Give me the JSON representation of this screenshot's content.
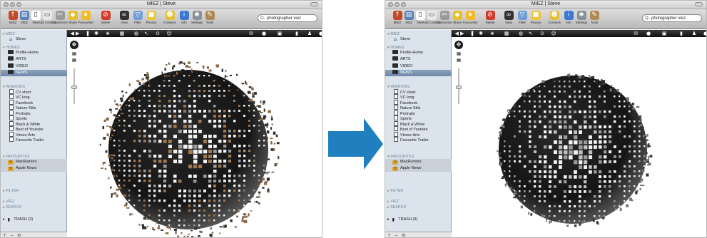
{
  "window": {
    "title": "MIEZ | Steve"
  },
  "toolbar": {
    "buttons": [
      {
        "label": "MIEZ",
        "icon": "miez-icon",
        "color": "#c04a2a"
      },
      {
        "label": "VIEZ",
        "icon": "viez-icon",
        "color": "#5a82b7"
      },
      {
        "label": "New",
        "icon": "new-icon",
        "color": "#ffffff"
      },
      {
        "label": "Add Content",
        "icon": "add-content-icon",
        "color": "#e9e9e9"
      },
      {
        "label": "Customize",
        "icon": "customize-icon",
        "color": "#9a9a9a"
      },
      {
        "label": "Share",
        "icon": "share-icon",
        "color": "#e6bf29"
      },
      {
        "label": "Favourites",
        "icon": "star-icon",
        "color": "#f2b923"
      },
      {
        "label": "Delete",
        "icon": "delete-icon",
        "color": "#d23a2a"
      },
      {
        "label": "View",
        "icon": "binoculars-icon",
        "color": "#333333"
      },
      {
        "label": "Filter",
        "icon": "filter-icon",
        "color": "#6f9ed4"
      },
      {
        "label": "Privacy",
        "icon": "lock-icon",
        "color": "#f0c333"
      },
      {
        "label": "Contacts",
        "icon": "contacts-icon",
        "color": "#e4c039"
      },
      {
        "label": "Info",
        "icon": "info-icon",
        "color": "#3b78d2"
      },
      {
        "label": "Settings",
        "icon": "gear-icon",
        "color": "#8a8f98"
      },
      {
        "label": "Tools",
        "icon": "tools-icon",
        "color": "#b08a55"
      }
    ],
    "search_value": "photographer viez",
    "search_icon": "search-icon"
  },
  "sidebar": {
    "sections": [
      {
        "heading": "MIEZ",
        "items": [
          {
            "label": "Steve",
            "icon": "home-icon"
          }
        ]
      },
      {
        "heading": "HOMES",
        "items": [
          {
            "label": "Profile-Home",
            "icon": "laptop-icon"
          },
          {
            "label": "ARTS",
            "icon": "laptop-icon"
          },
          {
            "label": "VIDEO",
            "icon": "laptop-icon"
          },
          {
            "label": "NEWS",
            "icon": "laptop-icon",
            "selected": true
          }
        ]
      },
      {
        "heading": "WINDOWS",
        "items": [
          {
            "label": "CV short",
            "icon": "document-icon"
          },
          {
            "label": "VC long",
            "icon": "document-icon"
          },
          {
            "label": "Facebook",
            "icon": "document-icon"
          },
          {
            "label": "Nature Stils",
            "icon": "document-icon"
          },
          {
            "label": "Portraits",
            "icon": "document-icon"
          },
          {
            "label": "Sports",
            "icon": "document-icon"
          },
          {
            "label": "Black & White",
            "icon": "document-icon"
          },
          {
            "label": "Best of Youtube",
            "icon": "document-icon"
          },
          {
            "label": "Vimeo-Arts",
            "icon": "document-icon"
          },
          {
            "label": "Favourite Trailer",
            "icon": "document-icon"
          }
        ]
      },
      {
        "heading": "FAVOURITES",
        "items": [
          {
            "label": "MacRumors",
            "icon": "rss-icon",
            "highlighted": true
          },
          {
            "label": "Apple News",
            "icon": "rss-icon",
            "highlighted": true
          }
        ]
      },
      {
        "heading": "FILTER",
        "items": []
      },
      {
        "heading": "VIEZ",
        "items": []
      },
      {
        "heading": "SEARCH",
        "items": []
      },
      {
        "heading": "TRASH (3)",
        "items": [],
        "icon": "trash-icon"
      }
    ],
    "footer": {
      "add": "+",
      "remove": "−",
      "gear": "⚙"
    }
  },
  "content_toolbar": {
    "left_buttons": [
      "◀ ▶",
      "❚",
      "✺",
      "★",
      "▦",
      "◍",
      "↖",
      "⊙",
      "☺"
    ],
    "right_buttons": [
      "✉",
      "●",
      "▣",
      "▮",
      "♟",
      "●"
    ]
  },
  "views": {
    "left": {
      "sphere_style": "scattered",
      "tile_color_photos": "#a07850"
    },
    "right": {
      "sphere_style": "compact",
      "tile_color_photos": "#e8e8e8"
    }
  },
  "transition_arrow_color": "#1f7fbf"
}
